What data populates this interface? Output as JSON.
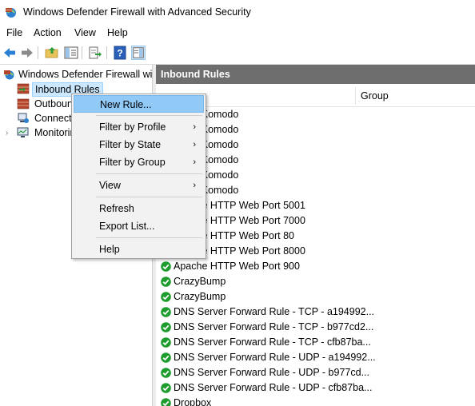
{
  "window": {
    "title": "Windows Defender Firewall with Advanced Security"
  },
  "menubar": {
    "items": [
      "File",
      "Action",
      "View",
      "Help"
    ]
  },
  "toolbar": {
    "buttons": [
      "back-arrow-icon",
      "forward-arrow-icon",
      "up-folder-icon",
      "show-hide-tree-icon",
      "export-list-icon",
      "help-icon",
      "show-hide-action-pane-icon"
    ]
  },
  "tree": {
    "root": "Windows Defender Firewall with Advanced Security",
    "items": [
      {
        "label": "Inbound Rules"
      },
      {
        "label": "Outbound Rules"
      },
      {
        "label": "Connection Security Rules"
      },
      {
        "label": "Monitoring"
      }
    ]
  },
  "main": {
    "pane_title": "Inbound Rules",
    "columns": {
      "name": "",
      "group": "Group"
    },
    "rows": [
      "...tate Komodo",
      "...tate Komodo",
      "...tate Komodo",
      "...tate Komodo",
      "...tate Komodo",
      "...tate Komodo",
      "Apache HTTP Web Port 5001",
      "Apache HTTP Web Port 7000",
      "Apache HTTP Web Port 80",
      "Apache HTTP Web Port 8000",
      "Apache HTTP Web Port 900",
      "CrazyBump",
      "CrazyBump",
      "DNS Server Forward Rule - TCP - a194992...",
      "DNS Server Forward Rule - TCP - b977cd2...",
      "DNS Server Forward Rule - TCP - cfb87ba...",
      "DNS Server Forward Rule - UDP - a194992...",
      "DNS Server Forward Rule - UDP - b977cd...",
      "DNS Server Forward Rule - UDP - cfb87ba...",
      "Dropbox"
    ]
  },
  "context_menu": {
    "items": [
      {
        "label": "New Rule...",
        "submenu": false,
        "highlighted": true
      },
      {
        "label": "Filter by Profile",
        "submenu": true
      },
      {
        "label": "Filter by State",
        "submenu": true
      },
      {
        "label": "Filter by Group",
        "submenu": true
      },
      {
        "label": "View",
        "submenu": true
      },
      {
        "label": "Refresh",
        "submenu": false
      },
      {
        "label": "Export List...",
        "submenu": false
      },
      {
        "label": "Help",
        "submenu": false
      }
    ],
    "submenu_arrow": "›"
  },
  "colors": {
    "pane_header_bg": "#6e6e6e",
    "menu_highlight": "#91c9f7",
    "check_green": "#1e9c2e"
  }
}
